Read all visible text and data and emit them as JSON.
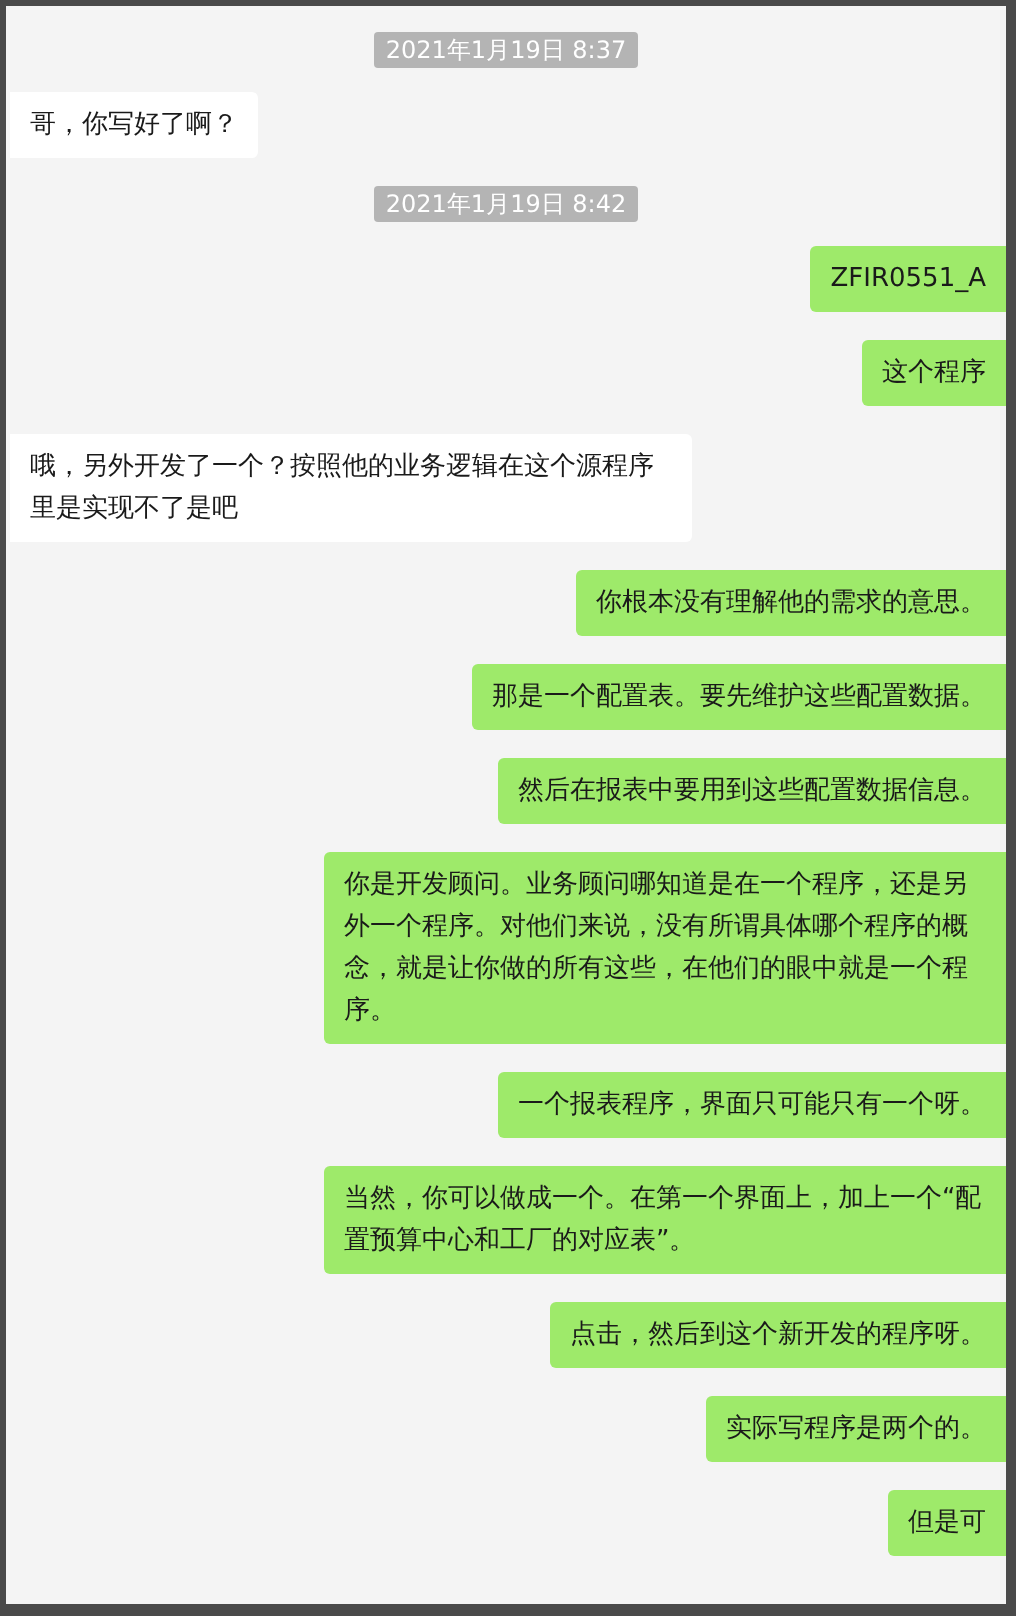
{
  "messages": [
    {
      "kind": "timestamp",
      "text": "2021年1月19日 8:37"
    },
    {
      "kind": "received",
      "text": "哥，你写好了啊？"
    },
    {
      "kind": "timestamp",
      "text": "2021年1月19日 8:42"
    },
    {
      "kind": "sent",
      "text": "ZFIR0551_A"
    },
    {
      "kind": "sent",
      "text": "这个程序"
    },
    {
      "kind": "received",
      "text": "哦，另外开发了一个？按照他的业务逻辑在这个源程序里是实现不了是吧"
    },
    {
      "kind": "sent",
      "text": "你根本没有理解他的需求的意思。"
    },
    {
      "kind": "sent",
      "text": "那是一个配置表。要先维护这些配置数据。"
    },
    {
      "kind": "sent",
      "text": "然后在报表中要用到这些配置数据信息。"
    },
    {
      "kind": "sent",
      "text": "你是开发顾问。业务顾问哪知道是在一个程序，还是另外一个程序。对他们来说，没有所谓具体哪个程序的概念，就是让你做的所有这些，在他们的眼中就是一个程序。"
    },
    {
      "kind": "sent",
      "text": "一个报表程序，界面只可能只有一个呀。"
    },
    {
      "kind": "sent",
      "text": "当然，你可以做成一个。在第一个界面上，加上一个“配置预算中心和工厂的对应表”。"
    },
    {
      "kind": "sent",
      "text": "点击，然后到这个新开发的程序呀。"
    },
    {
      "kind": "sent",
      "text": "实际写程序是两个的。"
    },
    {
      "kind": "sent",
      "text": "但是可"
    }
  ]
}
